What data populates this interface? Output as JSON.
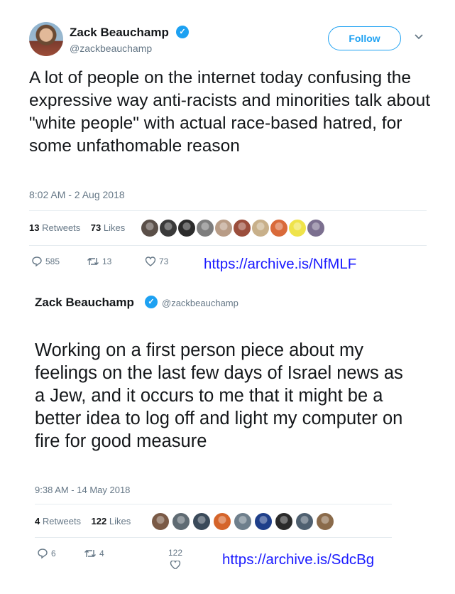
{
  "tweet1": {
    "name": "Zack Beauchamp",
    "handle": "@zackbeauchamp",
    "follow_label": "Follow",
    "text": "A lot of people on the internet today confusing the expressive way anti-racists and minorities talk about \"white people\" with actual race-based hatred, for some unfathomable reason",
    "timestamp": "8:02 AM - 2 Aug 2018",
    "retweets_count": "13",
    "retweets_label": "Retweets",
    "likes_count": "73",
    "likes_label": "Likes",
    "replies": "585",
    "retweets": "13",
    "likes": "73",
    "archive_link": "https://archive.is/NfMLF",
    "liker_colors": [
      "#5a4f48",
      "#3a3a3a",
      "#2b2b2b",
      "#7d7d7d",
      "#b89c86",
      "#9b4e3c",
      "#c8b08a",
      "#d96a3a",
      "#efe34a",
      "#7b6f8f"
    ]
  },
  "tweet2": {
    "name": "Zack Beauchamp",
    "handle": "@zackbeauchamp",
    "text": "Working on a first person piece about my feelings on the last few days of Israel news as a Jew, and it occurs to me that it might be a better idea to log off and light my computer on fire for good measure",
    "timestamp": "9:38 AM - 14 May 2018",
    "retweets_count": "4",
    "retweets_label": "Retweets",
    "likes_count": "122",
    "likes_label": "Likes",
    "replies": "6",
    "retweets": "4",
    "likes": "122",
    "archive_link": "https://archive.is/SdcBg",
    "liker_colors": [
      "#7a5a46",
      "#5f6b73",
      "#3a4a5a",
      "#d5642a",
      "#6e7f8c",
      "#1f3f8a",
      "#2a2a2a",
      "#4f6070",
      "#8a6a4a"
    ]
  },
  "colors": {
    "accent": "#1da1f2",
    "muted": "#657786",
    "link": "#1a1aff"
  }
}
